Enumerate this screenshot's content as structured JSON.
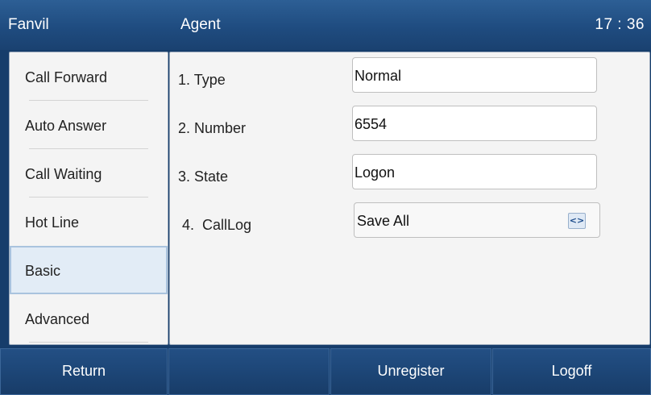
{
  "header": {
    "brand": "Fanvil",
    "title": "Agent",
    "clock": "17 : 36"
  },
  "sidebar": {
    "items": [
      {
        "label": "Call Forward"
      },
      {
        "label": "Auto Answer"
      },
      {
        "label": "Call Waiting"
      },
      {
        "label": "Hot Line"
      },
      {
        "label": "Basic",
        "selected": true
      },
      {
        "label": "Advanced"
      }
    ]
  },
  "form": {
    "rows": [
      {
        "label": "1.  Type",
        "value": "Normal"
      },
      {
        "label": "2.  Number",
        "value": "6554"
      },
      {
        "label": "3.  State",
        "value": "Logon"
      },
      {
        "label": " 4.  CallLog",
        "value": "Save All",
        "control": "selector"
      }
    ],
    "selector_icon": "left-right-arrows-icon",
    "selector_glyph": "<>"
  },
  "softkeys": {
    "return_label": "Return",
    "blank_label": "",
    "unregister_label": "Unregister",
    "logoff_label": "Logoff"
  },
  "colors": {
    "header": "#1f4c80",
    "softkey": "#1d4677",
    "panel": "#f4f4f4",
    "selected_item": "#e2ecf6"
  }
}
